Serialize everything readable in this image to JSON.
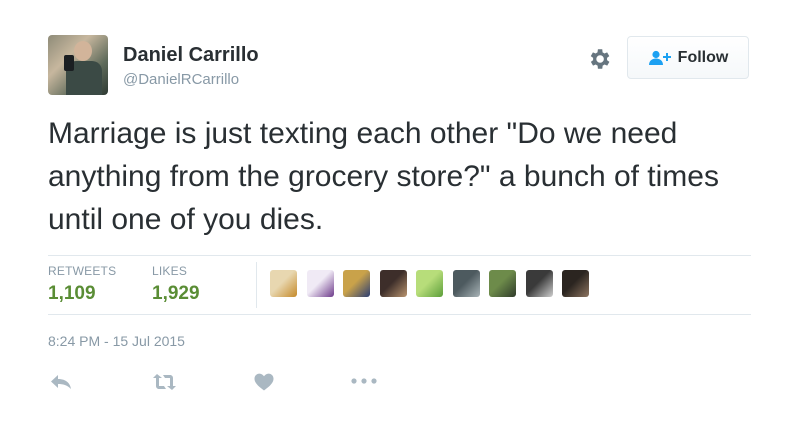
{
  "user": {
    "name": "Daniel Carrillo",
    "handle": "@DanielRCarrillo"
  },
  "follow_button": {
    "label": "Follow"
  },
  "tweet": {
    "text": "Marriage is just texting each other \"Do we need anything from the grocery store?\" a bunch of times until one of you dies.",
    "timestamp": "8:24 PM - 15 Jul 2015"
  },
  "stats": {
    "retweets_label": "RETWEETS",
    "retweets_count": "1,109",
    "likes_label": "LIKES",
    "likes_count": "1,929"
  },
  "likers": [
    {
      "colors": [
        "#e8d7b0",
        "#c58a2a"
      ]
    },
    {
      "colors": [
        "#f0eaf5",
        "#6d3a8a"
      ]
    },
    {
      "colors": [
        "#c9a24a",
        "#2c3e74"
      ]
    },
    {
      "colors": [
        "#3d2e2a",
        "#b9946f"
      ]
    },
    {
      "colors": [
        "#b7dd7a",
        "#5c9e3a"
      ]
    },
    {
      "colors": [
        "#4d5a5f",
        "#a9b4b8"
      ]
    },
    {
      "colors": [
        "#6d8b4a",
        "#2f3b2a"
      ]
    },
    {
      "colors": [
        "#3a3a3a",
        "#cfcfcf"
      ]
    },
    {
      "colors": [
        "#2b2520",
        "#8d7460"
      ]
    }
  ],
  "colors": {
    "stat_green": "#5a8d35",
    "muted": "#8899a6",
    "text": "#292f33",
    "action_icon": "#aab8c2"
  },
  "icons": {
    "gear": "gear-icon",
    "follow": "add-user-icon",
    "reply": "reply-icon",
    "retweet": "retweet-icon",
    "like": "heart-icon",
    "more": "more-dots-icon"
  }
}
